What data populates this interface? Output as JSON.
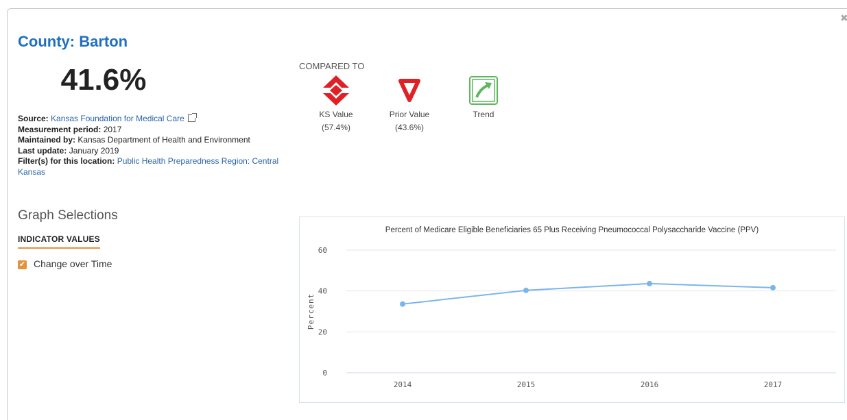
{
  "title": "County: Barton",
  "value": "41.6%",
  "meta": {
    "source_label": "Source:",
    "source_value": "Kansas Foundation for Medical Care",
    "period_label": "Measurement period:",
    "period_value": "2017",
    "maintained_label": "Maintained by:",
    "maintained_value": "Kansas Department of Health and Environment",
    "update_label": "Last update:",
    "update_value": "January 2019",
    "filter_label": "Filter(s) for this location:",
    "filter_value": "Public Health Preparedness Region: Central Kansas"
  },
  "compared": {
    "heading": "COMPARED TO",
    "items": [
      {
        "label": "KS Value",
        "value": "(57.4%)",
        "icon": "diverging-arrows-icon",
        "color": "#e02027"
      },
      {
        "label": "Prior Value",
        "value": "(43.6%)",
        "icon": "down-triangle-icon",
        "color": "#e02027"
      },
      {
        "label": "Trend",
        "value": "",
        "icon": "trend-up-icon",
        "color": "#5cb85c"
      }
    ]
  },
  "graph_selections": {
    "heading": "Graph Selections",
    "subheading": "INDICATOR VALUES",
    "option_label": "Change over Time",
    "option_checked": true
  },
  "chart_data": {
    "type": "line",
    "title": "Percent of Medicare Eligible Beneficiaries 65 Plus Receiving Pneumococcal Polysaccharide Vaccine (PPV)",
    "ylabel": "Percent",
    "xlabel": "",
    "categories": [
      "2014",
      "2015",
      "2016",
      "2017"
    ],
    "series": [
      {
        "values": [
          33.6,
          40.3,
          43.6,
          41.6
        ]
      }
    ],
    "ylim": [
      0,
      60
    ],
    "yticks": [
      "0",
      "20",
      "40",
      "60"
    ],
    "grid": true,
    "line_color": "#7cb5ec"
  }
}
